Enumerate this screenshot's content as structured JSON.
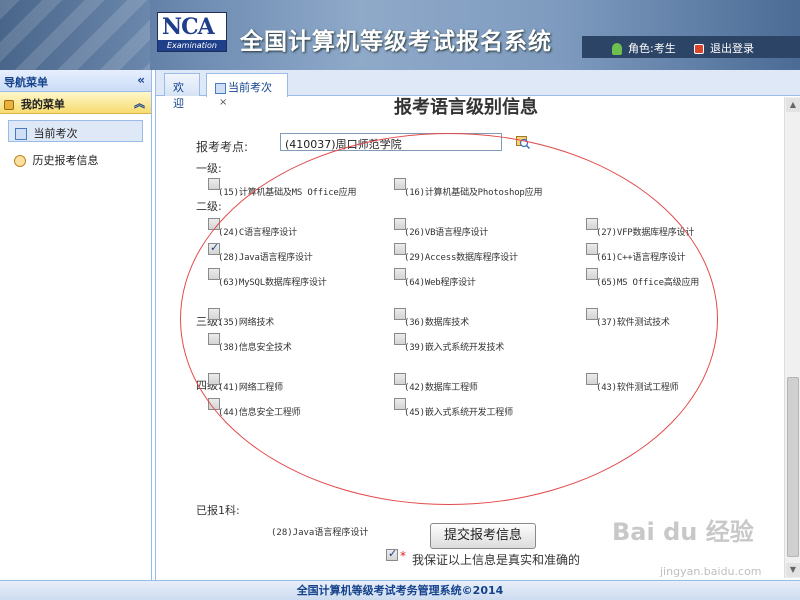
{
  "header": {
    "app_title": "全国计算机等级考试报名系统",
    "logo_text": "NCA",
    "logo_sub": "Examination",
    "role": "角色:考生",
    "logout": "退出登录"
  },
  "sidebar": {
    "nav_title": "导航菜单",
    "collapse": "«",
    "menu_title": "我的菜单",
    "menu_toggle": "︽",
    "items": [
      {
        "label": "当前考次",
        "active": true
      },
      {
        "label": "历史报考信息",
        "active": false
      }
    ]
  },
  "tabs": [
    {
      "label": "欢迎"
    },
    {
      "label": "当前考次",
      "close": "×"
    }
  ],
  "form": {
    "title": "报考语言级别信息",
    "site_label": "报考考点:",
    "site_value": "(410037)周口师范学院",
    "levels": {
      "level1": "一级:",
      "level2": "二级:",
      "level3": "三级:",
      "level4": "四级:"
    },
    "subjects": [
      {
        "id": "s15",
        "label": "(15)计算机基础及MS Office应用",
        "checked": false
      },
      {
        "id": "s16",
        "label": "(16)计算机基础及Photoshop应用",
        "checked": false
      },
      {
        "id": "s24",
        "label": "(24)C语言程序设计",
        "checked": false
      },
      {
        "id": "s26",
        "label": "(26)VB语言程序设计",
        "checked": false
      },
      {
        "id": "s27",
        "label": "(27)VFP数据库程序设计",
        "checked": false
      },
      {
        "id": "s28",
        "label": "(28)Java语言程序设计",
        "checked": true
      },
      {
        "id": "s29",
        "label": "(29)Access数据库程序设计",
        "checked": false
      },
      {
        "id": "s61",
        "label": "(61)C++语言程序设计",
        "checked": false
      },
      {
        "id": "s63",
        "label": "(63)MySQL数据库程序设计",
        "checked": false
      },
      {
        "id": "s64",
        "label": "(64)Web程序设计",
        "checked": false
      },
      {
        "id": "s65",
        "label": "(65)MS Office高级应用",
        "checked": false
      },
      {
        "id": "s35",
        "label": "(35)网络技术",
        "checked": false
      },
      {
        "id": "s36",
        "label": "(36)数据库技术",
        "checked": false
      },
      {
        "id": "s37",
        "label": "(37)软件测试技术",
        "checked": false
      },
      {
        "id": "s38",
        "label": "(38)信息安全技术",
        "checked": false
      },
      {
        "id": "s39",
        "label": "(39)嵌入式系统开发技术",
        "checked": false
      },
      {
        "id": "s41",
        "label": "(41)网络工程师",
        "checked": false
      },
      {
        "id": "s42",
        "label": "(42)数据库工程师",
        "checked": false
      },
      {
        "id": "s43",
        "label": "(43)软件测试工程师",
        "checked": false
      },
      {
        "id": "s44",
        "label": "(44)信息安全工程师",
        "checked": false
      },
      {
        "id": "s45",
        "label": "(45)嵌入式系统开发工程师",
        "checked": false
      }
    ],
    "reported_label": "已报1科:",
    "reported_value": "(28)Java语言程序设计",
    "confirm_text": "我保证以上信息是真实和准确的",
    "confirm_checked": true,
    "submit_label": "提交报考信息"
  },
  "footer": {
    "text": "全国计算机等级考试考务管理系统©2014"
  },
  "watermark": {
    "text": "Bai du 经验",
    "sub": "jingyan.baidu.com"
  }
}
